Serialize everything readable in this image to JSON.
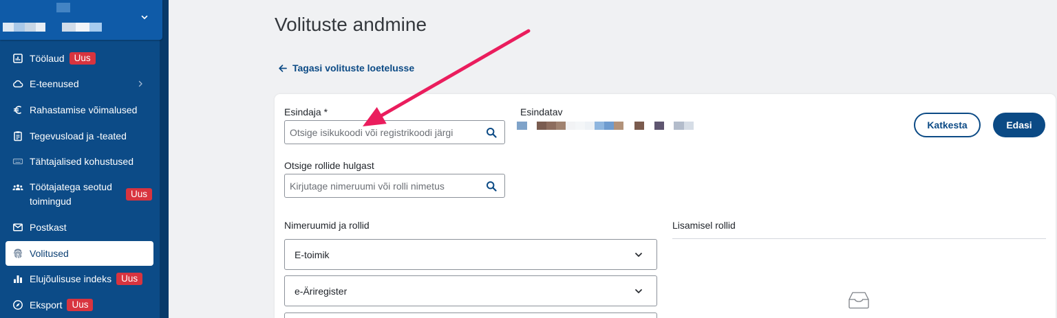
{
  "colors": {
    "brand_blue": "#0b4a85",
    "sidebar_bg": "#0c4b87",
    "badge_red": "#d8343f",
    "annotation_arrow": "#ea1d5d"
  },
  "sidebar": {
    "account_icon": "chevron-down-icon",
    "items": [
      {
        "label": "Töölaud",
        "icon": "dashboard-icon",
        "badge": "Uus"
      },
      {
        "label": "E-teenused",
        "icon": "cloud-icon",
        "submenu_icon": "chevron-right-icon"
      },
      {
        "label": "Rahastamise võimalused",
        "icon": "euro-icon"
      },
      {
        "label": "Tegevusload ja -teated",
        "icon": "clipboard-icon"
      },
      {
        "label": "Tähtajalised kohustused",
        "icon": "keyboard-icon"
      },
      {
        "label": "Töötajatega seotud toimingud",
        "icon": "people-icon",
        "badge": "Uus"
      },
      {
        "label": "Postkast",
        "icon": "envelope-icon"
      },
      {
        "label": "Volitused",
        "icon": "fingerprint-icon",
        "selected": true
      },
      {
        "label": "Elujõulisuse indeks",
        "icon": "bar-chart-icon",
        "badge": "Uus"
      },
      {
        "label": "Eksport",
        "icon": "compass-icon",
        "badge": "Uus"
      }
    ]
  },
  "page": {
    "title": "Volituste andmine",
    "back_link": {
      "label": "Tagasi volituste loetelusse",
      "icon": "arrow-left-icon"
    }
  },
  "form": {
    "representative": {
      "label": "Esindaja *",
      "placeholder": "Otsige isikukoodi või registrikoodi järgi",
      "icon": "search-icon"
    },
    "represented": {
      "label": "Esindatav"
    },
    "actions": {
      "cancel": "Katkesta",
      "next": "Edasi"
    },
    "role_search": {
      "label": "Otsige rollide hulgast",
      "placeholder": "Kirjutage nimeruumi või rolli nimetus",
      "icon": "search-icon"
    },
    "namespaces": {
      "label": "Nimeruumid ja rollid",
      "items": [
        {
          "label": "E-toimik",
          "expanded": false
        },
        {
          "label": "e-Äriregister",
          "expanded": false
        }
      ]
    },
    "added_roles": {
      "label": "Lisamisel rollid",
      "empty_icon": "empty-inbox-icon"
    }
  }
}
